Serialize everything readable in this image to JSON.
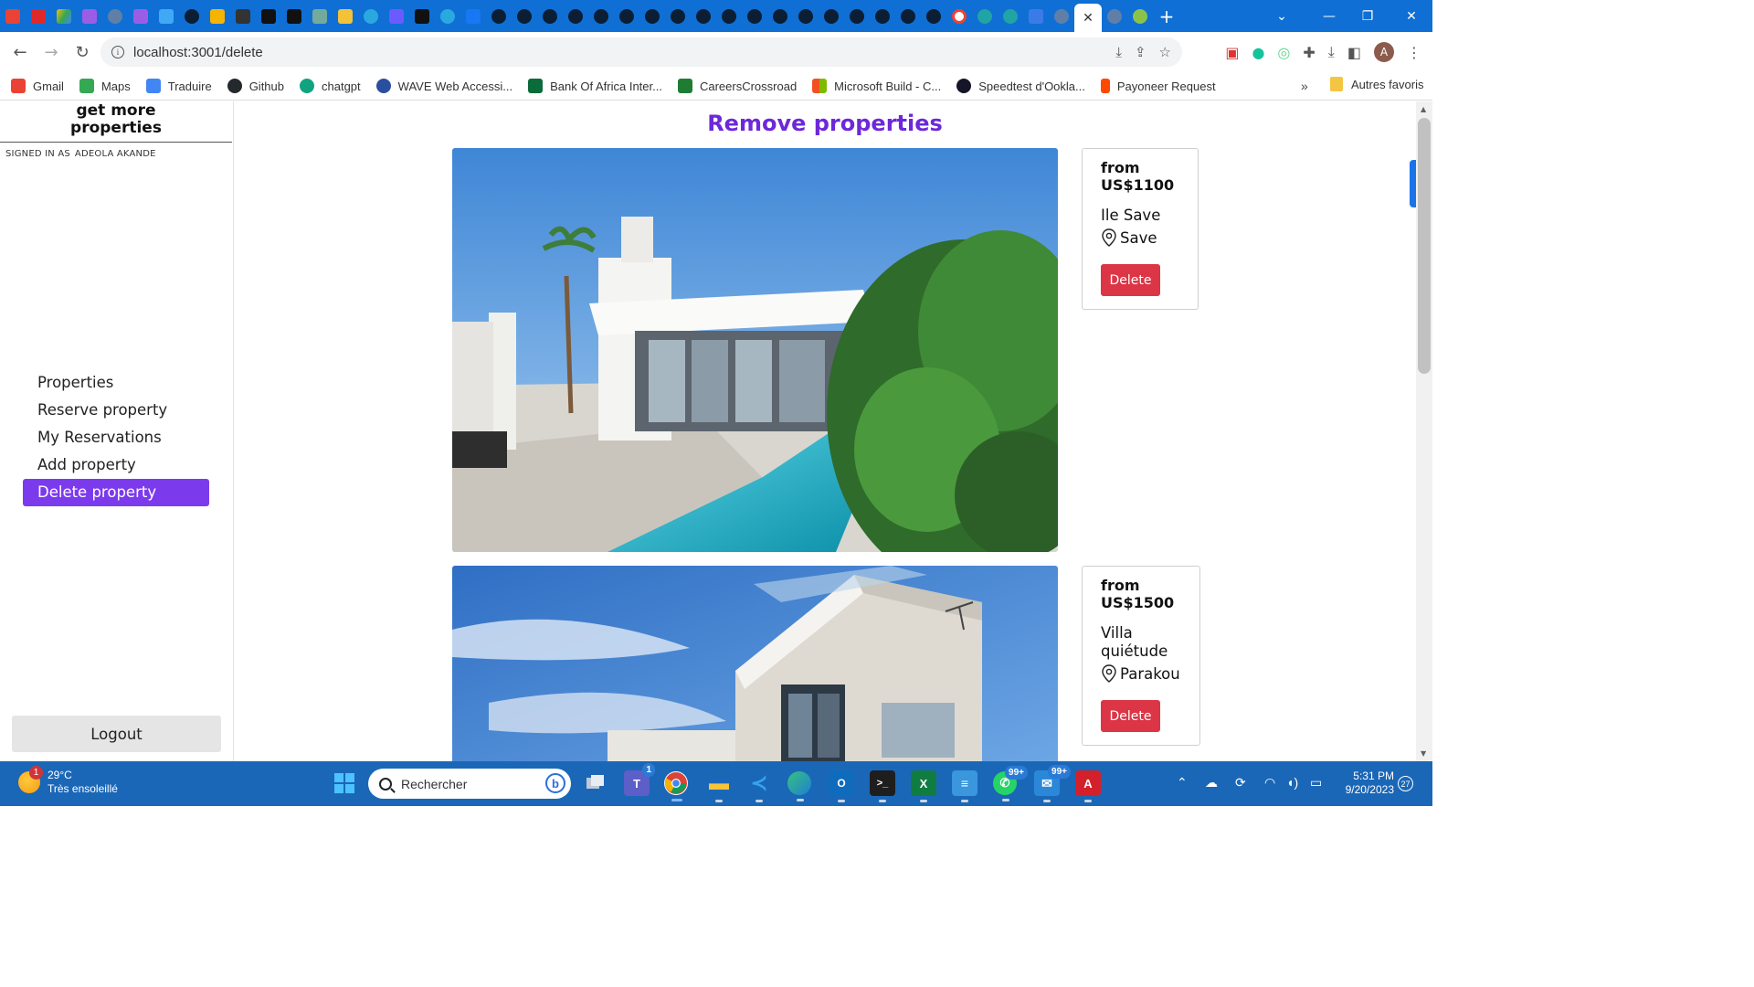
{
  "browser": {
    "url": "localhost:3001/delete",
    "bookmarks": [
      {
        "label": "Gmail",
        "color": "#ea4335"
      },
      {
        "label": "Maps",
        "color": "#34a853"
      },
      {
        "label": "Traduire",
        "color": "#4285f4"
      },
      {
        "label": "Github",
        "color": "#24292e"
      },
      {
        "label": "chatgpt",
        "color": "#10a37f"
      },
      {
        "label": "WAVE Web Accessi...",
        "color": "#2a4f9e"
      },
      {
        "label": "Bank Of Africa Inter...",
        "color": "#0b6b3a"
      },
      {
        "label": "CareersCrossroad",
        "color": "#1e7d32"
      },
      {
        "label": "Microsoft Build - C...",
        "color": "#f25022"
      },
      {
        "label": "Speedtest d'Ookla...",
        "color": "#141526"
      },
      {
        "label": "Payoneer Request",
        "color": "#ff4800"
      }
    ],
    "other_bookmarks": "Autres favoris",
    "profile_initial": "A"
  },
  "sidebar": {
    "brand_line1": "get more",
    "brand_line2": "properties",
    "signed_in_label": "SIGNED IN AS",
    "user_name": "ADEOLA AKANDE",
    "nav": [
      {
        "label": "Properties",
        "active": false
      },
      {
        "label": "Reserve property",
        "active": false
      },
      {
        "label": "My Reservations",
        "active": false
      },
      {
        "label": "Add property",
        "active": false
      },
      {
        "label": "Delete property",
        "active": true
      }
    ],
    "logout_label": "Logout"
  },
  "main": {
    "title": "Remove properties",
    "properties": [
      {
        "price_prefix": "from",
        "price": "US$1100",
        "name": "Ile Save",
        "location": "Save",
        "delete_label": "Delete"
      },
      {
        "price_prefix": "from",
        "price": "US$1500",
        "name": "Villa quiétude",
        "location": "Parakou",
        "delete_label": "Delete"
      }
    ]
  },
  "taskbar": {
    "weather_temp": "29°C",
    "weather_desc": "Très ensoleillé",
    "weather_badge": "1",
    "search_placeholder": "Rechercher",
    "teams_badge": "1",
    "whatsapp_badge": "99+",
    "mail_badge": "99+",
    "time": "5:31 PM",
    "date": "9/20/2023",
    "notifications": "27"
  },
  "colors": {
    "accent": "#7c3aed",
    "title": "#6d28d9",
    "delete": "#dc3545",
    "tabstrip": "#0f6fd4",
    "taskbar": "#1b67b7"
  }
}
